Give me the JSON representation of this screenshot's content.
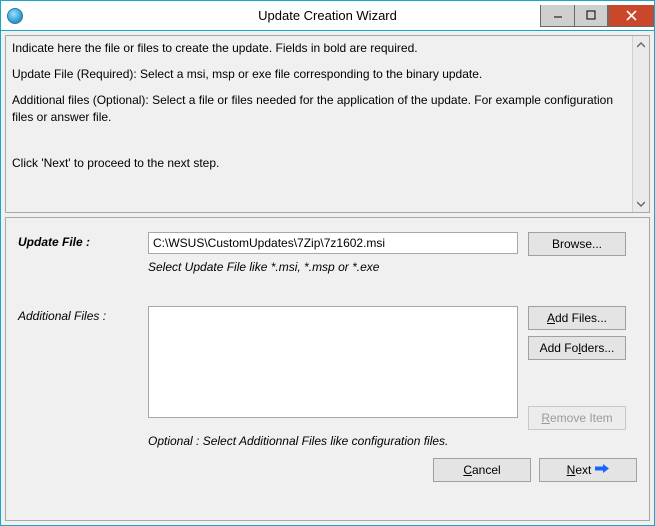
{
  "window": {
    "title": "Update Creation Wizard"
  },
  "instructions": {
    "line1": "Indicate here the file or files to create the update. Fields in bold are required.",
    "line2": "Update File (Required): Select a msi, msp or exe file corresponding to the binary update.",
    "line3": "Additional files (Optional): Select a file or files needed for the application of the update. For example configuration files or answer file.",
    "line4": "Click 'Next' to proceed to the next step."
  },
  "form": {
    "updateFile": {
      "label": "Update File :",
      "value": "C:\\WSUS\\CustomUpdates\\7Zip\\7z1602.msi",
      "hint": "Select Update File like *.msi, *.msp or *.exe",
      "browseLabel": "Browse..."
    },
    "additionalFiles": {
      "label": "Additional Files :",
      "hint": "Optional : Select Additionnal Files like configuration files.",
      "addFilesPrefix": "A",
      "addFilesSuffix": "dd Files...",
      "addFoldersPrefix": "Add Fo",
      "addFoldersSuffix": "lders...",
      "removePrefix": "R",
      "removeSuffix": "emove Item"
    },
    "footer": {
      "cancelPrefix": "C",
      "cancelSuffix": "ancel",
      "nextPrefix": "N",
      "nextSuffix": "ext"
    }
  }
}
